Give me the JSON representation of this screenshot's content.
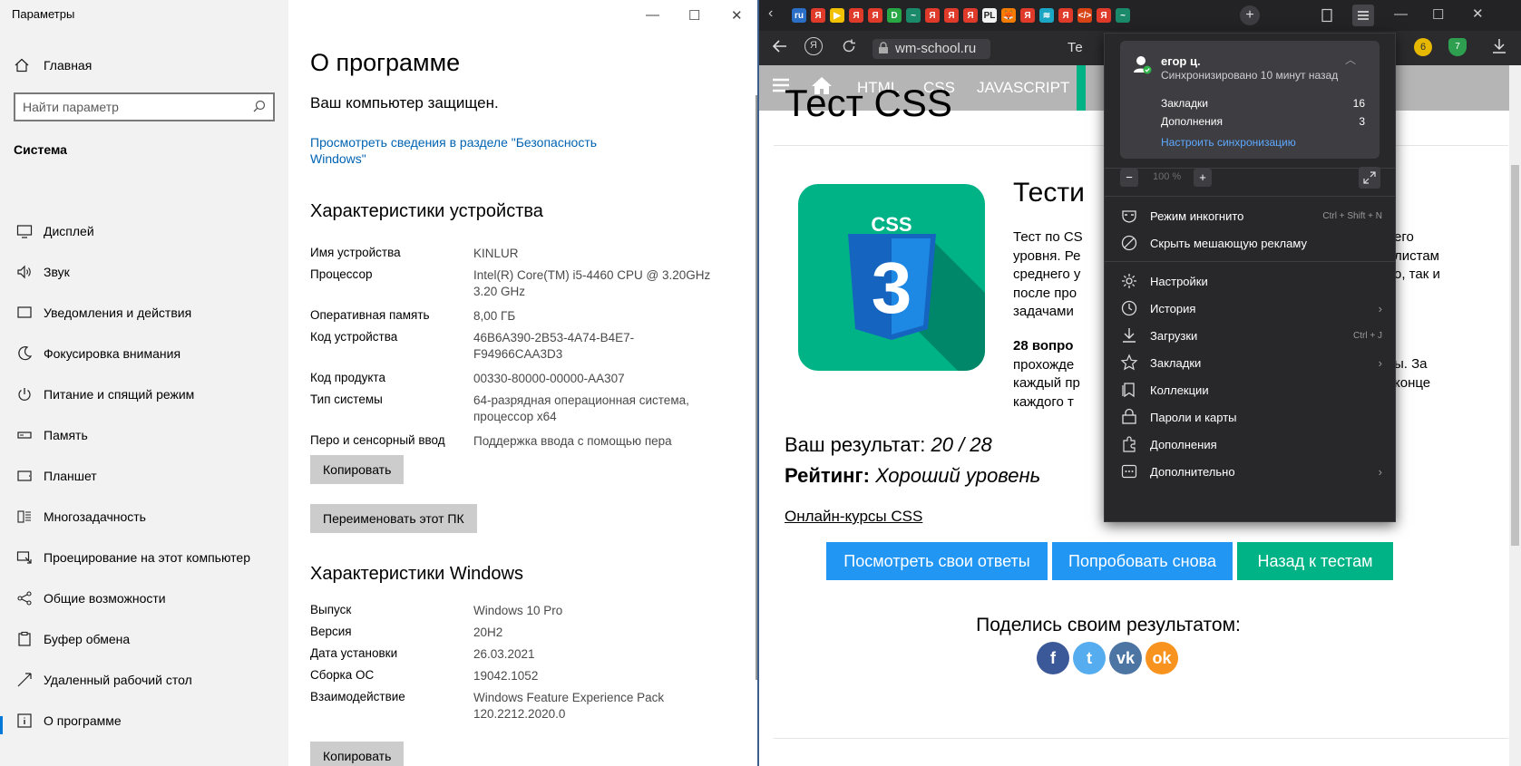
{
  "settings": {
    "window_title": "Параметры",
    "window_controls": {
      "minimize": "—",
      "maximize": "☐",
      "close": "✕"
    },
    "home_label": "Главная",
    "search_placeholder": "Найти параметр",
    "section_title": "Система",
    "nav": [
      {
        "label": "Дисплей",
        "icon": "display-icon"
      },
      {
        "label": "Звук",
        "icon": "sound-icon"
      },
      {
        "label": "Уведомления и действия",
        "icon": "notifications-icon"
      },
      {
        "label": "Фокусировка внимания",
        "icon": "focus-moon-icon"
      },
      {
        "label": "Питание и спящий режим",
        "icon": "power-icon"
      },
      {
        "label": "Память",
        "icon": "storage-icon"
      },
      {
        "label": "Планшет",
        "icon": "tablet-icon"
      },
      {
        "label": "Многозадачность",
        "icon": "multitasking-icon"
      },
      {
        "label": "Проецирование на этот компьютер",
        "icon": "projecting-icon"
      },
      {
        "label": "Общие возможности",
        "icon": "shared-experiences-icon"
      },
      {
        "label": "Буфер обмена",
        "icon": "clipboard-icon"
      },
      {
        "label": "Удаленный рабочий стол",
        "icon": "remote-desktop-icon"
      },
      {
        "label": "О программе",
        "icon": "info-icon",
        "selected": true
      }
    ],
    "page_title": "О программе",
    "protected_text": "Ваш компьютер защищен.",
    "security_link_line1": "Просмотреть сведения в разделе \"Безопасность",
    "security_link_line2": "Windows\"",
    "device_specs_title": "Характеристики устройства",
    "device_specs": [
      {
        "key": "Имя устройства",
        "value": "KINLUR"
      },
      {
        "key": "Процессор",
        "value": "Intel(R) Core(TM) i5-4460  CPU @ 3.20GHz   3.20 GHz"
      },
      {
        "key": "Оперативная память",
        "value": "8,00 ГБ"
      },
      {
        "key": "Код устройства",
        "value": "46B6A390-2B53-4A74-B4E7-F94966CAA3D3"
      },
      {
        "key": "Код продукта",
        "value": "00330-80000-00000-AA307"
      },
      {
        "key": "Тип системы",
        "value": "64-разрядная операционная система, процессор x64"
      },
      {
        "key": "Перо и сенсорный ввод",
        "value": "Поддержка ввода с помощью пера"
      }
    ],
    "copy_button": "Копировать",
    "rename_button": "Переименовать этот ПК",
    "windows_specs_title": "Характеристики Windows",
    "windows_specs": [
      {
        "key": "Выпуск",
        "value": "Windows 10 Pro"
      },
      {
        "key": "Версия",
        "value": "20H2"
      },
      {
        "key": "Дата установки",
        "value": "26.03.2021"
      },
      {
        "key": "Сборка ОС",
        "value": "19042.1052"
      },
      {
        "key": "Взаимодействие",
        "value": "Windows Feature Experience Pack 120.2212.2020.0"
      }
    ],
    "copy_button_2": "Копировать"
  },
  "browser": {
    "tabbar": {
      "new_tab": "+",
      "favicons": [
        "ru",
        "Я",
        "▶",
        "Я",
        "Я",
        "D",
        "~",
        "Я",
        "Я",
        "Я",
        "PL",
        "🦊",
        "Я",
        "≋",
        "Я",
        "</>",
        "Я",
        "~"
      ]
    },
    "url": "wm-school.ru",
    "page_title_fragment": "Те",
    "colors": {
      "accent_blue": "#2196f3",
      "accent_green": "#00b386",
      "css_tile": "#00b386"
    },
    "site": {
      "nav": [
        "HTML",
        "CSS",
        "JAVASCRIPT"
      ],
      "heading": "Тест CSS",
      "logo_text": "CSS",
      "logo_number": "3",
      "sub_heading": "Тести",
      "desc_lines": [
        "Тест по CS",
        "уровня. Ре",
        "среднего у",
        "после про",
        "задачами"
      ],
      "desc_right": [
        "его",
        "листам",
        "о, так и",
        ""
      ],
      "count_bold": "28 вопро",
      "count_lines": [
        "прохожде",
        "каждый пр",
        "каждого т"
      ],
      "count_right": [
        "ы. За",
        "конце"
      ],
      "result_label": "Ваш результат:",
      "result_value": "20 / 28",
      "rating_label": "Рейтинг:",
      "rating_value": "Хороший уровень",
      "courses_link": "Онлайн-курсы CSS",
      "buttons": [
        "Посмотреть свои ответы",
        "Попробовать снова",
        "Назад к тестам"
      ],
      "share_text": "Поделись своим результатом:",
      "social": [
        {
          "name": "facebook",
          "glyph": "f",
          "color": "#3b5998"
        },
        {
          "name": "twitter",
          "glyph": "t",
          "color": "#55acee"
        },
        {
          "name": "vk",
          "glyph": "vk",
          "color": "#4c75a3"
        },
        {
          "name": "odnoklassniki",
          "glyph": "ok",
          "color": "#f7931e"
        }
      ]
    },
    "menu": {
      "user_name": "егор ц.",
      "sync_status": "Синхронизировано 10 минут назад",
      "bookmarks_label": "Закладки",
      "bookmarks_count": "16",
      "extensions_label": "Дополнения",
      "extensions_count": "3",
      "sync_settings": "Настроить синхронизацию",
      "zoom_minus": "−",
      "zoom_value": "100 %",
      "zoom_plus": "+",
      "items": [
        {
          "label": "Режим инкогнито",
          "shortcut": "Ctrl + Shift + N",
          "icon": "incognito-icon"
        },
        {
          "label": "Скрыть мешающую рекламу",
          "icon": "block-ads-icon"
        },
        {
          "label": "Настройки",
          "icon": "settings-gear-icon"
        },
        {
          "label": "История",
          "icon": "history-clock-icon",
          "submenu": true
        },
        {
          "label": "Загрузки",
          "shortcut": "Ctrl + J",
          "icon": "download-icon"
        },
        {
          "label": "Закладки",
          "icon": "bookmark-star-icon",
          "submenu": true
        },
        {
          "label": "Коллекции",
          "icon": "collections-icon"
        },
        {
          "label": "Пароли и карты",
          "icon": "passwords-icon"
        },
        {
          "label": "Дополнения",
          "icon": "extensions-icon"
        },
        {
          "label": "Дополнительно",
          "icon": "more-icon",
          "submenu": true
        }
      ]
    }
  }
}
